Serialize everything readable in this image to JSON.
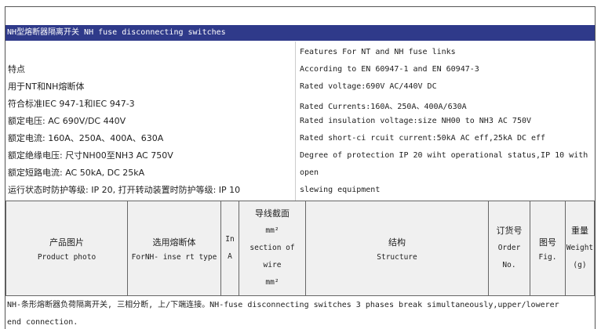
{
  "title": "NH型熔断器隔离开关 NH fuse disconnecting switches",
  "features_cn": [
    "特点",
    "用于NT和NH熔断体",
    "符合标准IEC 947-1和IEC 947-3",
    "额定电压: AC 690V/DC 440V",
    "额定电流: 160A、250A、400A、630A",
    "额定绝缘电压: 尺寸NH00至NH3 AC 750V",
    "额定短路电流: AC 50kA, DC 25kA",
    "运行状态时防护等级: IP 20, 打开转动装置时防护等级: IP 10"
  ],
  "features_en": [
    "Features For NT and NH fuse links",
    "According to EN 60947-1 and EN 60947-3",
    "Rated voltage:690V AC/440V DC",
    "Rated Currents:160A、250A、400A/630A",
    "Rated insulation voltage:size NH00 to NH3 AC 750V",
    "Rated short-ci rcuit current:50kA AC eff,25kA DC eff",
    "Degree of protection IP 20 wiht operational status,IP 10 with",
    "open",
    "slewing equipment"
  ],
  "table_header": {
    "photo_cn": "产品图片",
    "photo_en": "Product photo",
    "fuse_cn": "选用熔断体",
    "fuse_en": "ForNH- inse rt type",
    "in_label": "In",
    "in_unit": "A",
    "wire_cn": "导线截面",
    "wire_unit_top": "mm²",
    "wire_en1": "section of",
    "wire_en2": "wire",
    "wire_unit_bottom": "mm²",
    "structure_cn": "结构",
    "structure_en": "Structure",
    "order_cn": "订货号",
    "order_en1": "Order",
    "order_en2": "No.",
    "fig_cn": "图号",
    "fig_en": "Fig.",
    "weight_cn": "重量",
    "weight_en": "Weight",
    "weight_unit": "(g)"
  },
  "footer_line1": "NH-条形熔断器负荷隔离开关, 三相分断, 上/下端连接。NH-fuse disconnecting switches 3 phases break simultaneously,upper/lowerer",
  "footer_line2": "end connection."
}
